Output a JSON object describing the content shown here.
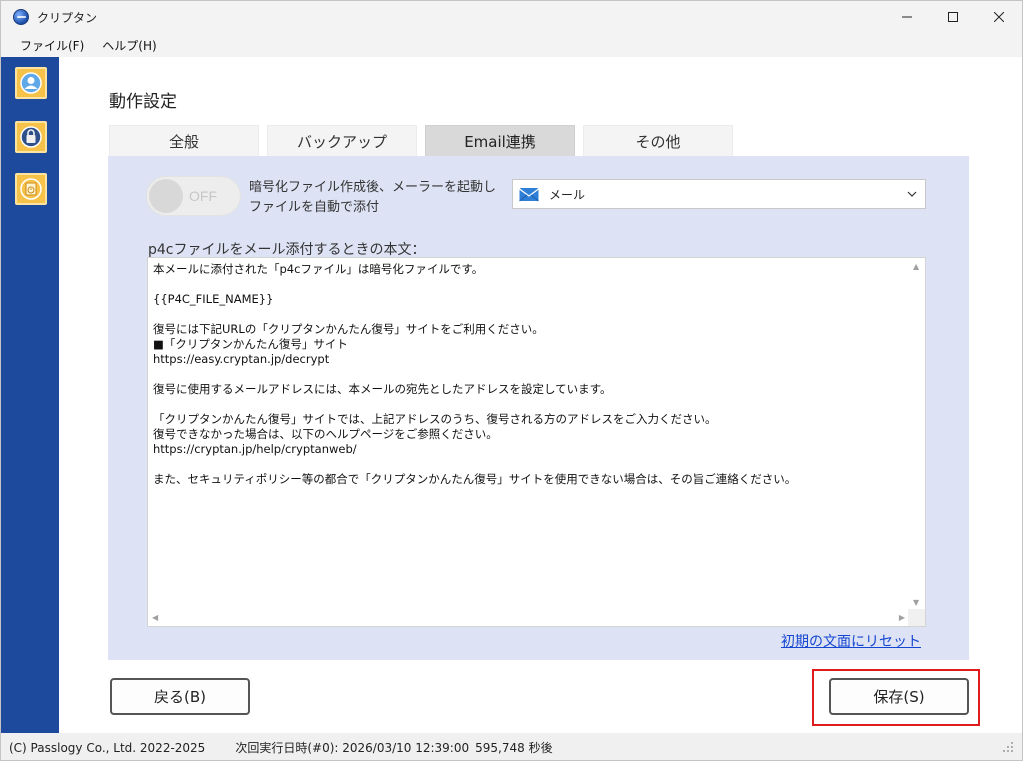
{
  "window": {
    "title": "クリプタン"
  },
  "menu": {
    "file": "ファイル(F)",
    "help": "ヘルプ(H)"
  },
  "sidebar": {
    "items": [
      {
        "icon": "user-profile-icon"
      },
      {
        "icon": "lock-globe-icon"
      },
      {
        "icon": "clock-document-icon"
      }
    ]
  },
  "page": {
    "title": "動作設定"
  },
  "tabs": [
    {
      "label": "全般",
      "active": false
    },
    {
      "label": "バックアップ",
      "active": false
    },
    {
      "label": "Email連携",
      "active": true
    },
    {
      "label": "その他",
      "active": false
    }
  ],
  "email": {
    "toggle_label": "OFF",
    "toggle_state": false,
    "toggle_description": "暗号化ファイル作成後、メーラーを起動しファイルを自動で添付",
    "mailer_selected": "メール",
    "body_label": "p4cファイルをメール添付するときの本文：",
    "body_text": "本メールに添付された「p4cファイル」は暗号化ファイルです。\n\n{{P4C_FILE_NAME}}\n\n復号には下記URLの「クリプタンかんたん復号」サイトをご利用ください。\n■「クリプタンかんたん復号」サイト\nhttps://easy.cryptan.jp/decrypt\n\n復号に使用するメールアドレスには、本メールの宛先としたアドレスを設定しています。\n\n「クリプタンかんたん復号」サイトでは、上記アドレスのうち、復号される方のアドレスをご入力ください。\n復号できなかった場合は、以下のヘルプページをご参照ください。\nhttps://cryptan.jp/help/cryptanweb/\n\nまた、セキュリティポリシー等の都合で「クリプタンかんたん復号」サイトを使用できない場合は、その旨ご連絡ください。",
    "reset_link": "初期の文面にリセット"
  },
  "buttons": {
    "back": "戻る(B)",
    "save": "保存(S)"
  },
  "status": {
    "copyright": "(C) Passlogy Co., Ltd. 2022-2025",
    "next_run": "次回実行日時(#0): 2026/03/10 12:39:00",
    "countdown": "595,748 秒後"
  },
  "colors": {
    "sidebar": "#1d4a9c",
    "panel": "#dde3f4",
    "link": "#1546d1",
    "highlight": "#e01b1b",
    "sidebar_button": "#f6c24a"
  }
}
